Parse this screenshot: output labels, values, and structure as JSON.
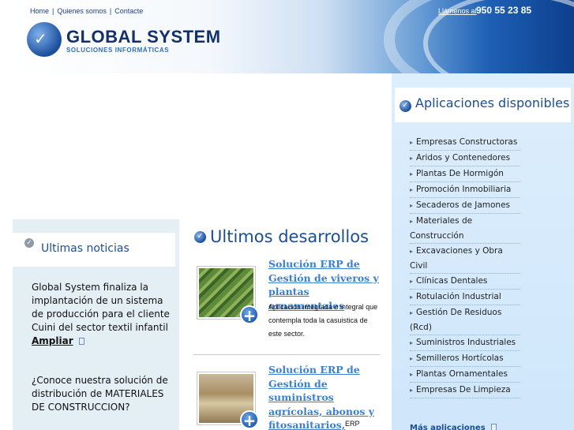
{
  "header": {
    "nav": [
      "Home",
      "Quienes somos",
      "Contacte"
    ],
    "brand": "GLOBAL SYSTEM",
    "brand_subtitle": "SOLUCIONES INFORMÁTICAS",
    "phone_label": "Llámenos al",
    "phone": "950 55 23 85"
  },
  "news": {
    "title": "Ultimas noticias",
    "items": [
      {
        "text": "Global System finaliza la implantación de un sistema de producción para el cliente Cuini del sector textil infantil",
        "more": "Ampliar"
      },
      {
        "text": "¿Conoce nuestra solución de distribución de MATERIALES DE CONSTRUCCION?",
        "more": ""
      }
    ]
  },
  "developments": {
    "title": "Ultimos desarrollos",
    "items": [
      {
        "title": "Solución ERP de Gestión de viveros y plantas ornamentales",
        "description": "Aplicación integrada e integral que contempla toda la casuistica de este sector."
      },
      {
        "title": "Solución ERP de Gestión de suministros agrícolas, abonos y fitosanitarios,",
        "description": "ERP"
      }
    ]
  },
  "apps": {
    "title": "Aplicaciones disponibles",
    "items": [
      "Empresas Constructoras",
      "Aridos y Contenedores",
      "Plantas De Hormigón",
      "Promoción Inmobiliaria",
      "Secaderos de Jamones",
      "Materiales de Construcción",
      "Excavaciones y Obra Civil",
      "Clínicas Dentales",
      "Rotulación Industrial",
      "Gestión De Residuos (Rcd)",
      "Suministros Industriales",
      "Semilleros Hortícolas",
      "Plantas Ornamentales",
      "Empresas De Limpieza"
    ],
    "more": "Más aplicaciones"
  },
  "colors": {
    "accent": "#1b4f92",
    "link": "#3b7fd0",
    "sidebar_bg": "#e4eef5",
    "apps_bg": "#ddeefc"
  }
}
